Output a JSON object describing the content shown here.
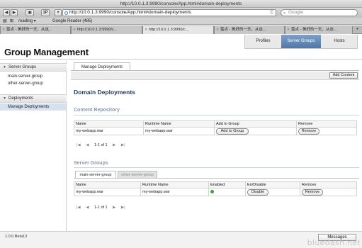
{
  "window": {
    "title": "http://10.0.1.3:9990/console/App.html#domain-deployments"
  },
  "toolbar": {
    "url": "http://10.0.1.3:9990/console/App.html#domain-deployments",
    "search_placeholder": "Google",
    "tp_label": "1P",
    "plus_label": "+",
    "reload_glyph": "C",
    "back_glyph": "◀",
    "forward_glyph": "▶"
  },
  "bookmarks": {
    "reading": "reading ▾",
    "google_reader": "Google Reader (485)"
  },
  "tabs": [
    {
      "label": "蓝点 - 美好的一天，从这...",
      "active": false
    },
    {
      "label": "http://10.0.1.3:9990/c...",
      "active": false
    },
    {
      "label": "http://10.0.1.3:9990/c...",
      "active": true
    },
    {
      "label": "蓝点 - 美好的一天，从这...",
      "active": false
    },
    {
      "label": "蓝点 - 美好的一天，从这...",
      "active": false
    }
  ],
  "app": {
    "title": "Group Management",
    "nav": [
      {
        "label": "Profiles",
        "selected": false
      },
      {
        "label": "Server Groups",
        "selected": true
      },
      {
        "label": "Hosts",
        "selected": false
      }
    ]
  },
  "sidebar": {
    "server_groups_header": "Server Groups",
    "server_groups": [
      "main-server-group",
      "other-server-group"
    ],
    "deployments_header": "Deployments",
    "deployments_item": "Manage Deployments"
  },
  "main": {
    "tab_label": "Manage Deployments",
    "add_content_label": "Add Content",
    "title": "Domain Deployments",
    "content_repository": {
      "title": "Content Repository",
      "columns": [
        "Name",
        "Runtime Name",
        "Add to Group",
        "Remove"
      ],
      "rows": [
        {
          "name": "my-webapp.war",
          "runtime_name": "my-webapp.war",
          "add_label": "Add to Group",
          "remove_label": "Remove"
        }
      ],
      "pager": "1-1 of 1"
    },
    "server_groups": {
      "title": "Server Groups",
      "tabs": [
        "main-server-group",
        "other-server-group"
      ],
      "columns": [
        "Name",
        "Runtime Name",
        "Enabled",
        "En/Disable",
        "Remove"
      ],
      "rows": [
        {
          "name": "my-webapp.war",
          "runtime_name": "my-webapp.war",
          "enabled": true,
          "toggle_label": "Disable",
          "remove_label": "Remove"
        }
      ],
      "pager": "1-1 of 1"
    }
  },
  "footer": {
    "version": "1.0.0.Beta13",
    "messages_label": "Messages"
  },
  "colors": {
    "nav_selected": "#4d77ab",
    "heading": "#233b5c",
    "section_title": "#8a96a6",
    "enabled_dot": "#3aa43a",
    "sidebar_selected": "#d7e1ee"
  },
  "watermark": "bluedash.net"
}
